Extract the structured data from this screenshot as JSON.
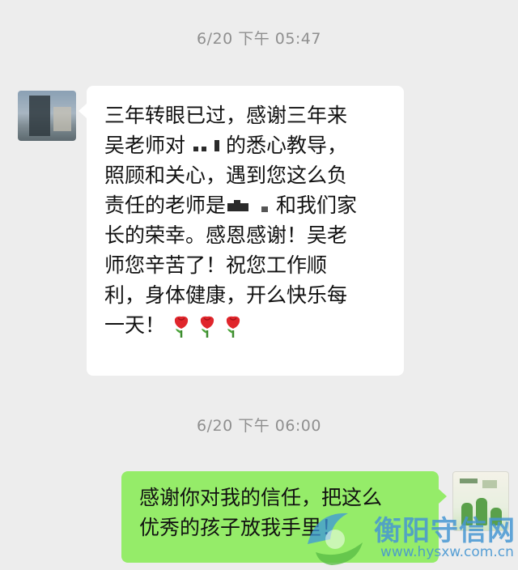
{
  "timestamps": [
    "6/20 下午 05:47",
    "6/20 下午 06:00"
  ],
  "incoming_message": {
    "line1": "三年转眼已过，感谢三年来",
    "line2_a": "吴老师对",
    "line2_b": "的悉心教导，",
    "line3": "照顾和关心，遇到您这么负",
    "line4_a": "责任的老师是",
    "line4_b": "和我们家",
    "line5": "长的荣幸。感恩感谢！吴老",
    "line6": "师您辛苦了！祝您工作顺",
    "line7": "利，身体健康，开么快乐每",
    "line8": "一天！",
    "emoji": [
      "rose-emoji",
      "rose-emoji",
      "rose-emoji"
    ]
  },
  "outgoing_message": {
    "line1": "感谢你对我的信任，把这么",
    "line2": "优秀的孩子放我手里！"
  },
  "watermark": {
    "name": "衡阳守信网",
    "url": "www.hysxw.com.cn"
  },
  "colors": {
    "background": "#ededed",
    "incoming_bubble": "#ffffff",
    "outgoing_bubble": "#95ec69",
    "timestamp_text": "#8f8f8f"
  }
}
